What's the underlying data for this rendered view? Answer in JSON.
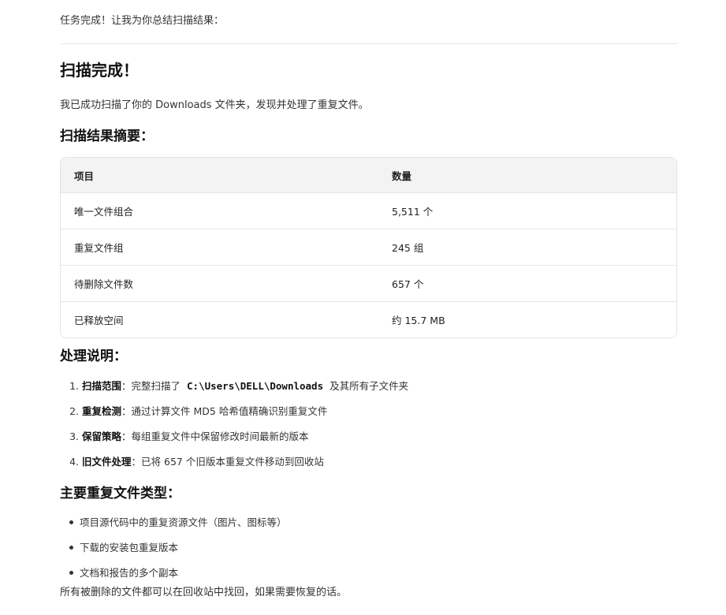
{
  "intro_text": "任务完成！让我为你总结扫描结果：",
  "heading": "扫描完成！",
  "description": "我已成功扫描了你的 Downloads 文件夹，发现并处理了重复文件。",
  "summary": {
    "title": "扫描结果摘要：",
    "columns": [
      "项目",
      "数量"
    ],
    "rows": [
      {
        "item": "唯一文件组合",
        "count": "5,511 个"
      },
      {
        "item": "重复文件组",
        "count": "245 组"
      },
      {
        "item": "待删除文件数",
        "count": "657 个"
      },
      {
        "item": "已释放空间",
        "count": "约 15.7 MB"
      }
    ]
  },
  "notes": {
    "title": "处理说明：",
    "items": [
      {
        "num": "1.",
        "label": "扫描范围",
        "sep": "：",
        "pre": "完整扫描了",
        "code": "C:\\Users\\DELL\\Downloads",
        "post": "及其所有子文件夹"
      },
      {
        "num": "2.",
        "label": "重复检测",
        "sep": "：",
        "pre": "通过计算文件 MD5 哈希值精确识别重复文件",
        "code": "",
        "post": ""
      },
      {
        "num": "3.",
        "label": "保留策略",
        "sep": "：",
        "pre": "每组重复文件中保留修改时间最新的版本",
        "code": "",
        "post": ""
      },
      {
        "num": "4.",
        "label": "旧文件处理",
        "sep": "：",
        "pre": "已将 657 个旧版本重复文件移动到回收站",
        "code": "",
        "post": ""
      }
    ]
  },
  "types": {
    "title": "主要重复文件类型：",
    "items": [
      "项目源代码中的重复资源文件（图片、图标等）",
      "下载的安装包重复版本",
      "文档和报告的多个副本"
    ]
  },
  "footer": "所有被删除的文件都可以在回收站中找回，如果需要恢复的话。"
}
